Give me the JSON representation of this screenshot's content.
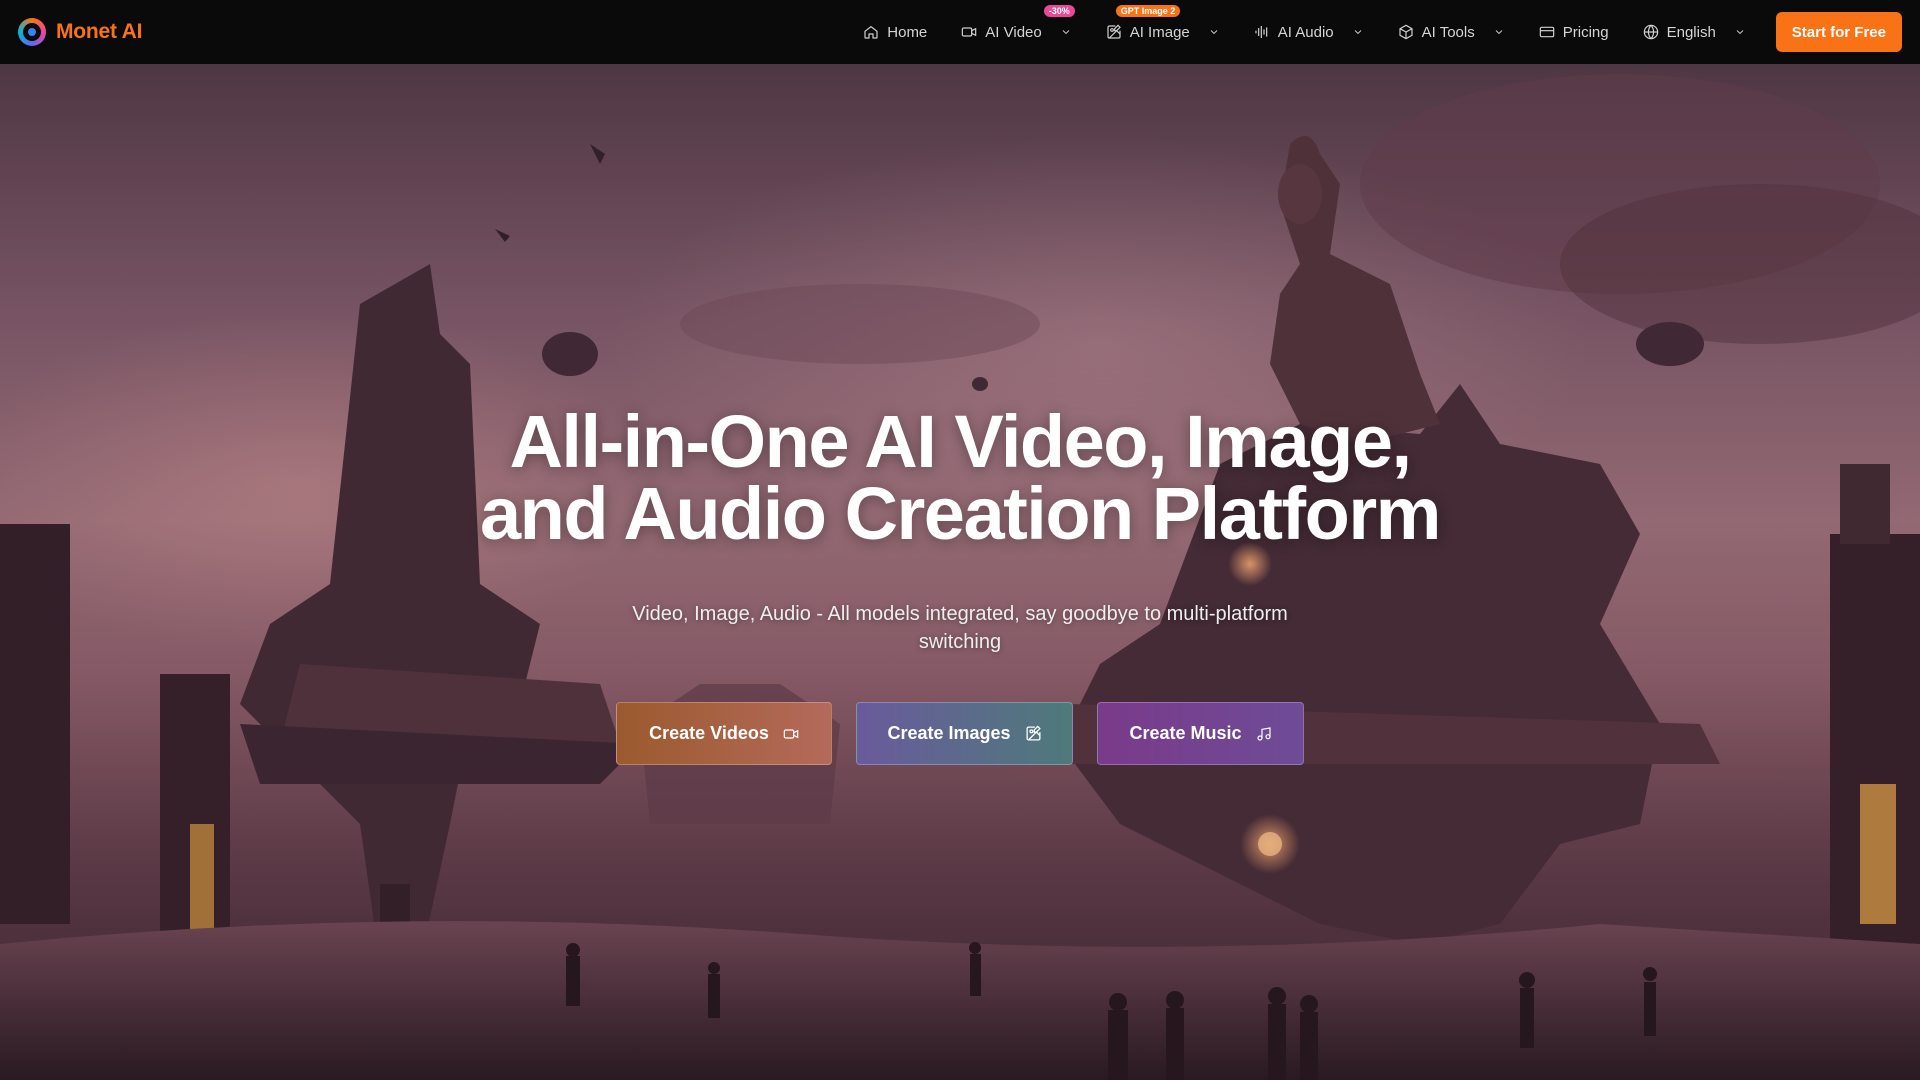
{
  "brand": {
    "name": "Monet AI"
  },
  "nav": {
    "items": [
      {
        "label": "Home",
        "icon": "home-icon"
      },
      {
        "label": "AI Video",
        "icon": "video-icon",
        "badge": "-30%"
      },
      {
        "label": "AI Image",
        "icon": "image-edit-icon",
        "badge": "GPT Image 2"
      },
      {
        "label": "AI Audio",
        "icon": "audio-wave-icon"
      },
      {
        "label": "AI Tools",
        "icon": "cube-icon"
      },
      {
        "label": "Pricing",
        "icon": "credit-card-icon"
      },
      {
        "label": "English",
        "icon": "globe-icon"
      }
    ],
    "cta": "Start for Free"
  },
  "hero": {
    "headline_line1": "All-in-One AI Video, Image,",
    "headline_line2": "and Audio Creation Platform",
    "subtitle": "Video, Image, Audio - All models integrated, say goodbye to multi-platform switching",
    "buttons": [
      {
        "label": "Create Videos",
        "icon": "video-icon"
      },
      {
        "label": "Create Images",
        "icon": "image-edit-icon"
      },
      {
        "label": "Create Music",
        "icon": "music-note-icon"
      }
    ]
  },
  "colors": {
    "accent": "#f97316",
    "badge_pink": "#ec4899",
    "navbar_bg": "#0a0a0a"
  }
}
